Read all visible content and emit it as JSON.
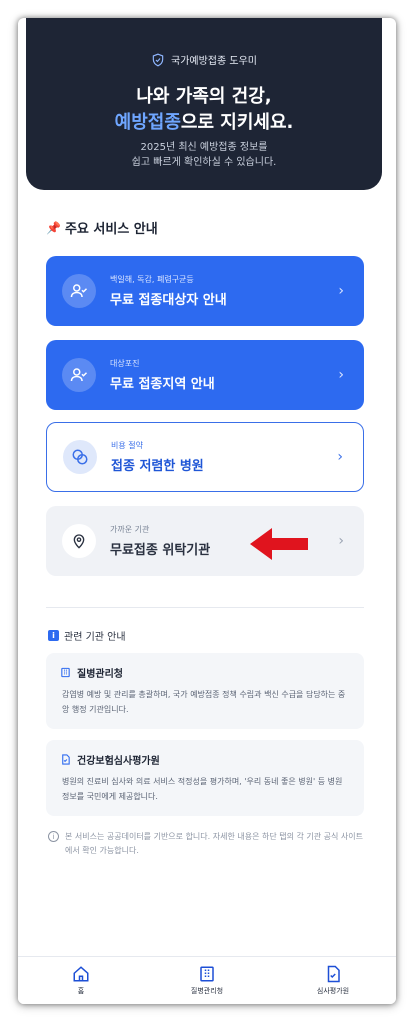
{
  "hero": {
    "badge": "국가예방접종 도우미",
    "title_line1": "나와 가족의 건강,",
    "title_accent": "예방접종",
    "title_rest": "으로 지키세요.",
    "subtitle_line1": "2025년 최신 예방접종 정보를",
    "subtitle_line2": "쉽고 빠르게 확인하실 수 있습니다."
  },
  "services": {
    "title": "주요 서비스 안내",
    "cards": [
      {
        "small": "백일해, 독감, 폐렴구균등",
        "big": "무료 접종대상자 안내",
        "icon": "user-check-icon"
      },
      {
        "small": "대상포진",
        "big": "무료 접종지역 안내",
        "icon": "user-check-icon"
      },
      {
        "small": "비용 절약",
        "big": "접종 저렴한 병원",
        "icon": "coins-icon"
      },
      {
        "small": "가까운 기관",
        "big": "무료접종 위탁기관",
        "icon": "map-pin-icon"
      }
    ]
  },
  "related": {
    "title": "관련 기관 안내",
    "orgs": [
      {
        "name": "질병관리청",
        "desc": "감염병 예방 및 관리를 총괄하며, 국가 예방접종 정책 수립과 백신 수급을 담당하는 중앙 행정 기관입니다."
      },
      {
        "name": "건강보험심사평가원",
        "desc": "병원의 진료비 심사와 의료 서비스 적정성을 평가하며, '우리 동네 좋은 병원' 등 병원 정보를 국민에게 제공합니다."
      }
    ]
  },
  "notice": "본 서비스는 공공데이터를 기반으로 합니다. 자세한 내용은 하단 탭의 각 기관 공식 사이트에서 확인 가능합니다.",
  "nav": [
    {
      "label": "홈",
      "icon": "home-icon"
    },
    {
      "label": "질병관리청",
      "icon": "building-icon"
    },
    {
      "label": "심사평가원",
      "icon": "document-icon"
    }
  ],
  "colors": {
    "hero_bg": "#1e2535",
    "accent": "#6fa6ff",
    "primary": "#2d6af0",
    "annotation_arrow": "#e0141e"
  }
}
